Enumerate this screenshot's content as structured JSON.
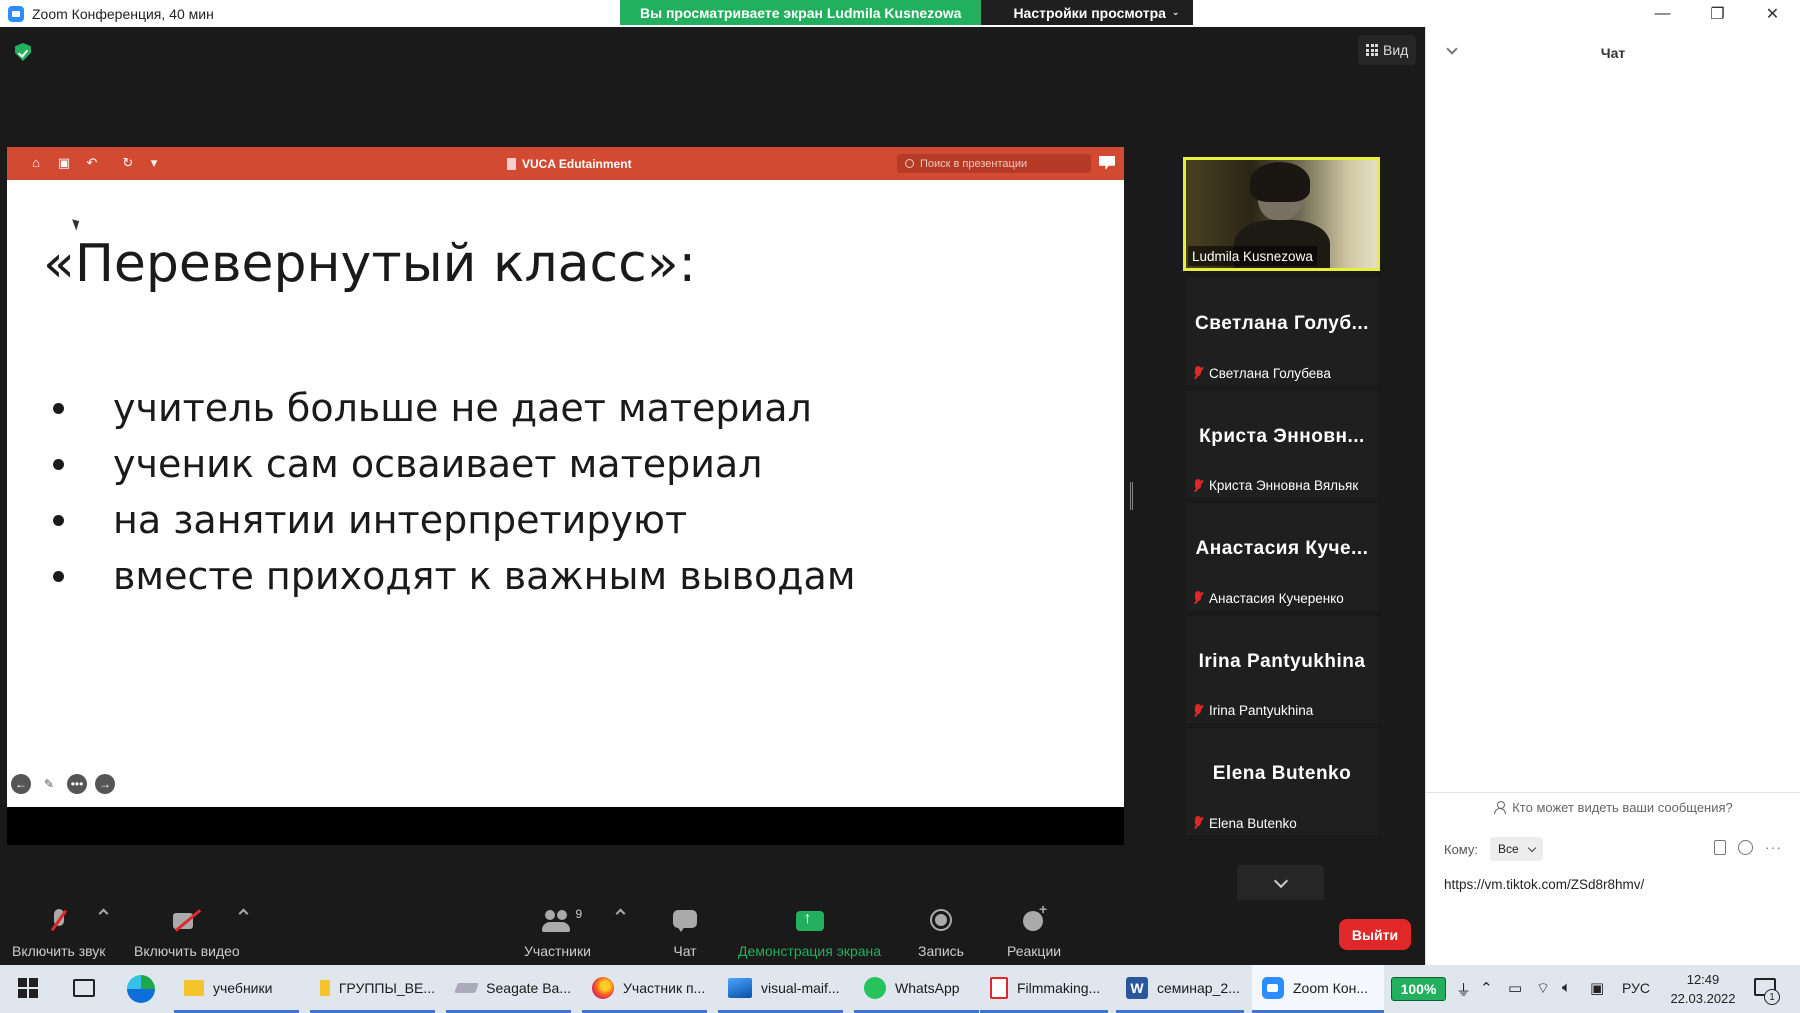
{
  "window": {
    "title": "Zoom Конференция, 40 мин",
    "share_banner": "Вы просматриваете экран Ludmila Kusnezowa",
    "view_options": "Настройки просмотра",
    "controls": {
      "minimize": "—",
      "restore": "❐",
      "close": "✕"
    }
  },
  "main": {
    "view_button": "Вид",
    "ppt": {
      "doc_title": "VUCA Edutainment",
      "search_placeholder": "Поиск в презентации"
    },
    "slide": {
      "title": "«Перевернутый класс»:",
      "bullets": [
        "учитель больше не дает материал",
        "ученик сам осваивает материал",
        "на занятии интерпретируют",
        "вместе приходят к важным выводам"
      ]
    }
  },
  "gallery": {
    "active": {
      "name": "Ludmila Kusnezowa"
    },
    "tiles": [
      {
        "display": "Светлана Голуб...",
        "name": "Светлана Голубева"
      },
      {
        "display": "Криста Энновн...",
        "name": "Криста Энновна Вяльяк"
      },
      {
        "display": "Анастасия Куче...",
        "name": "Анастасия Кучеренко"
      },
      {
        "display": "Irina Pantyukhina",
        "name": "Irina Pantyukhina"
      },
      {
        "display": "Elena Butenko",
        "name": "Elena Butenko"
      }
    ]
  },
  "toolbar": {
    "unmute": "Включить звук",
    "start_video": "Включить видео",
    "participants": "Участники",
    "participants_count": "9",
    "chat": "Чат",
    "share_screen": "Демонстрация экрана",
    "record": "Запись",
    "reactions": "Реакции",
    "leave": "Выйти",
    "share_color": "#23b05e",
    "leave_color": "#e02828"
  },
  "chat": {
    "title": "Чат",
    "visibility": "Кто может видеть ваши сообщения?",
    "to_label": "Кому:",
    "recipient": "Все",
    "input_value": "https://vm.tiktok.com/ZSd8r8hmv/"
  },
  "taskbar": {
    "items": [
      {
        "label": "учебники",
        "icon": "folder-icon"
      },
      {
        "label": "ГРУППЫ_ВЕ...",
        "icon": "folder-icon"
      },
      {
        "label": "Seagate Ba...",
        "icon": "drive-icon"
      },
      {
        "label": "Участник п...",
        "icon": "firefox-icon"
      },
      {
        "label": "visual-maif...",
        "icon": "photos-icon"
      },
      {
        "label": "WhatsApp",
        "icon": "whatsapp-icon"
      },
      {
        "label": "Filmmaking...",
        "icon": "pdf-icon"
      },
      {
        "label": "семинар_2...",
        "icon": "word-icon"
      },
      {
        "label": "Zoom Кон...",
        "icon": "zoom-icon"
      }
    ],
    "battery": "100%",
    "language": "РУС",
    "time": "12:49",
    "date": "22.03.2022",
    "notifications": "1"
  }
}
